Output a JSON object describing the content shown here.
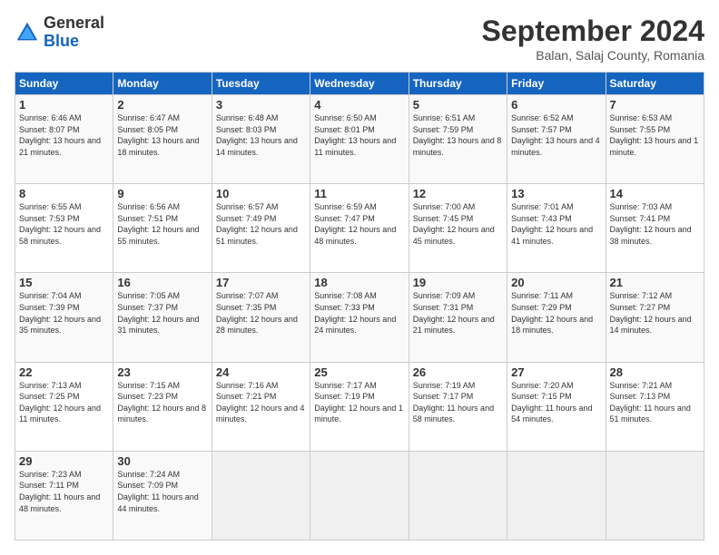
{
  "logo": {
    "general": "General",
    "blue": "Blue"
  },
  "header": {
    "month": "September 2024",
    "location": "Balan, Salaj County, Romania"
  },
  "days": [
    "Sunday",
    "Monday",
    "Tuesday",
    "Wednesday",
    "Thursday",
    "Friday",
    "Saturday"
  ],
  "weeks": [
    [
      {
        "day": "1",
        "sunrise": "6:46 AM",
        "sunset": "8:07 PM",
        "daylight": "13 hours and 21 minutes."
      },
      {
        "day": "2",
        "sunrise": "6:47 AM",
        "sunset": "8:05 PM",
        "daylight": "13 hours and 18 minutes."
      },
      {
        "day": "3",
        "sunrise": "6:48 AM",
        "sunset": "8:03 PM",
        "daylight": "13 hours and 14 minutes."
      },
      {
        "day": "4",
        "sunrise": "6:50 AM",
        "sunset": "8:01 PM",
        "daylight": "13 hours and 11 minutes."
      },
      {
        "day": "5",
        "sunrise": "6:51 AM",
        "sunset": "7:59 PM",
        "daylight": "13 hours and 8 minutes."
      },
      {
        "day": "6",
        "sunrise": "6:52 AM",
        "sunset": "7:57 PM",
        "daylight": "13 hours and 4 minutes."
      },
      {
        "day": "7",
        "sunrise": "6:53 AM",
        "sunset": "7:55 PM",
        "daylight": "13 hours and 1 minute."
      }
    ],
    [
      {
        "day": "8",
        "sunrise": "6:55 AM",
        "sunset": "7:53 PM",
        "daylight": "12 hours and 58 minutes."
      },
      {
        "day": "9",
        "sunrise": "6:56 AM",
        "sunset": "7:51 PM",
        "daylight": "12 hours and 55 minutes."
      },
      {
        "day": "10",
        "sunrise": "6:57 AM",
        "sunset": "7:49 PM",
        "daylight": "12 hours and 51 minutes."
      },
      {
        "day": "11",
        "sunrise": "6:59 AM",
        "sunset": "7:47 PM",
        "daylight": "12 hours and 48 minutes."
      },
      {
        "day": "12",
        "sunrise": "7:00 AM",
        "sunset": "7:45 PM",
        "daylight": "12 hours and 45 minutes."
      },
      {
        "day": "13",
        "sunrise": "7:01 AM",
        "sunset": "7:43 PM",
        "daylight": "12 hours and 41 minutes."
      },
      {
        "day": "14",
        "sunrise": "7:03 AM",
        "sunset": "7:41 PM",
        "daylight": "12 hours and 38 minutes."
      }
    ],
    [
      {
        "day": "15",
        "sunrise": "7:04 AM",
        "sunset": "7:39 PM",
        "daylight": "12 hours and 35 minutes."
      },
      {
        "day": "16",
        "sunrise": "7:05 AM",
        "sunset": "7:37 PM",
        "daylight": "12 hours and 31 minutes."
      },
      {
        "day": "17",
        "sunrise": "7:07 AM",
        "sunset": "7:35 PM",
        "daylight": "12 hours and 28 minutes."
      },
      {
        "day": "18",
        "sunrise": "7:08 AM",
        "sunset": "7:33 PM",
        "daylight": "12 hours and 24 minutes."
      },
      {
        "day": "19",
        "sunrise": "7:09 AM",
        "sunset": "7:31 PM",
        "daylight": "12 hours and 21 minutes."
      },
      {
        "day": "20",
        "sunrise": "7:11 AM",
        "sunset": "7:29 PM",
        "daylight": "12 hours and 18 minutes."
      },
      {
        "day": "21",
        "sunrise": "7:12 AM",
        "sunset": "7:27 PM",
        "daylight": "12 hours and 14 minutes."
      }
    ],
    [
      {
        "day": "22",
        "sunrise": "7:13 AM",
        "sunset": "7:25 PM",
        "daylight": "12 hours and 11 minutes."
      },
      {
        "day": "23",
        "sunrise": "7:15 AM",
        "sunset": "7:23 PM",
        "daylight": "12 hours and 8 minutes."
      },
      {
        "day": "24",
        "sunrise": "7:16 AM",
        "sunset": "7:21 PM",
        "daylight": "12 hours and 4 minutes."
      },
      {
        "day": "25",
        "sunrise": "7:17 AM",
        "sunset": "7:19 PM",
        "daylight": "12 hours and 1 minute."
      },
      {
        "day": "26",
        "sunrise": "7:19 AM",
        "sunset": "7:17 PM",
        "daylight": "11 hours and 58 minutes."
      },
      {
        "day": "27",
        "sunrise": "7:20 AM",
        "sunset": "7:15 PM",
        "daylight": "11 hours and 54 minutes."
      },
      {
        "day": "28",
        "sunrise": "7:21 AM",
        "sunset": "7:13 PM",
        "daylight": "11 hours and 51 minutes."
      }
    ],
    [
      {
        "day": "29",
        "sunrise": "7:23 AM",
        "sunset": "7:11 PM",
        "daylight": "11 hours and 48 minutes."
      },
      {
        "day": "30",
        "sunrise": "7:24 AM",
        "sunset": "7:09 PM",
        "daylight": "11 hours and 44 minutes."
      },
      null,
      null,
      null,
      null,
      null
    ]
  ]
}
